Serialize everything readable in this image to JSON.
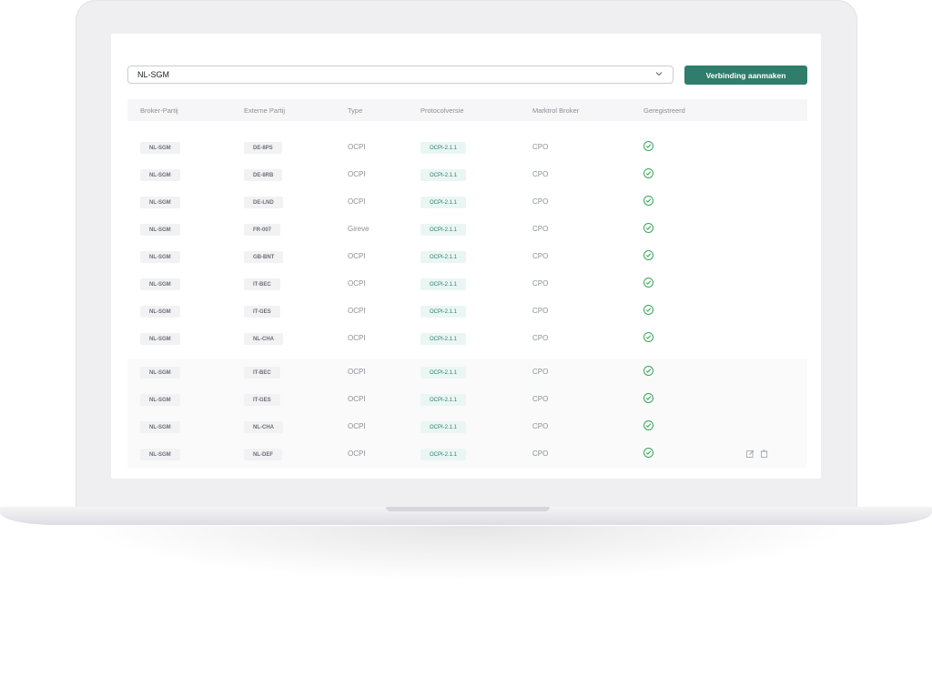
{
  "selector": {
    "value": "NL-SGM"
  },
  "create_button": {
    "label": "Verbinding aanmaken"
  },
  "table": {
    "columns": [
      "Broker-Partij",
      "Externe Partij",
      "Type",
      "Protocolversie",
      "Marktrol Broker",
      "Geregistreerd"
    ],
    "rows": [
      {
        "broker": "NL-SGM",
        "extern": "DE-8PS",
        "type": "OCPI",
        "protocol": "OCPI-2.1.1",
        "role": "CPO"
      },
      {
        "broker": "NL-SGM",
        "extern": "DE-8RB",
        "type": "OCPI",
        "protocol": "OCPI-2.1.1",
        "role": "CPO"
      },
      {
        "broker": "NL-SGM",
        "extern": "DE-LND",
        "type": "OCPI",
        "protocol": "OCPI-2.1.1",
        "role": "CPO"
      },
      {
        "broker": "NL-SGM",
        "extern": "FR-007",
        "type": "Gireve",
        "protocol": "OCPI-2.1.1",
        "role": "CPO"
      },
      {
        "broker": "NL-SGM",
        "extern": "GB-BNT",
        "type": "OCPI",
        "protocol": "OCPI-2.1.1",
        "role": "CPO"
      },
      {
        "broker": "NL-SGM",
        "extern": "IT-BEC",
        "type": "OCPI",
        "protocol": "OCPI-2.1.1",
        "role": "CPO"
      },
      {
        "broker": "NL-SGM",
        "extern": "IT-GES",
        "type": "OCPI",
        "protocol": "OCPI-2.1.1",
        "role": "CPO"
      },
      {
        "broker": "NL-SGM",
        "extern": "NL-CHA",
        "type": "OCPI",
        "protocol": "OCPI-2.1.1",
        "role": "CPO"
      },
      {
        "broker": "NL-SGM",
        "extern": "IT-BEC",
        "type": "OCPI",
        "protocol": "OCPI-2.1.1",
        "role": "CPO"
      },
      {
        "broker": "NL-SGM",
        "extern": "IT-GES",
        "type": "OCPI",
        "protocol": "OCPI-2.1.1",
        "role": "CPO"
      },
      {
        "broker": "NL-SGM",
        "extern": "NL-CHA",
        "type": "OCPI",
        "protocol": "OCPI-2.1.1",
        "role": "CPO"
      },
      {
        "broker": "NL-SGM",
        "extern": "NL-DEF",
        "type": "OCPI",
        "protocol": "OCPI-2.1.1",
        "role": "CPO"
      }
    ]
  },
  "colors": {
    "accent": "#2f7d6a",
    "check": "#3aa55a"
  },
  "icons": {
    "dropdown": "chevron-down-icon",
    "registered": "check-circle-icon",
    "edit": "edit-icon",
    "delete": "trash-icon"
  }
}
